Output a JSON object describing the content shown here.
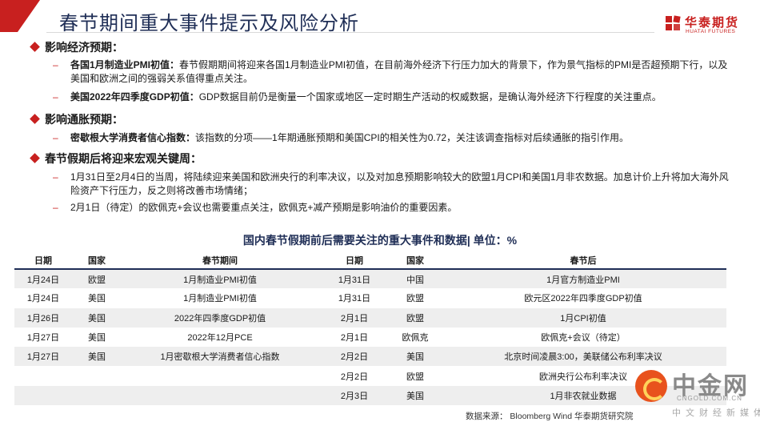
{
  "header": {
    "title": "春节期间重大事件提示及风险分析",
    "logo_cn": "华泰期货",
    "logo_en": "HUATAI FUTURES"
  },
  "sections": [
    {
      "heading": "影响经济预期：",
      "bullets": [
        {
          "label": "各国1月制造业PMI初值：",
          "text": "春节假期期间将迎来各国1月制造业PMI初值，在目前海外经济下行压力加大的背景下，作为景气指标的PMI是否超预期下行，以及美国和欧洲之间的强弱关系值得重点关注。"
        },
        {
          "label": "美国2022年四季度GDP初值：",
          "text": "GDP数据目前仍是衡量一个国家或地区一定时期生产活动的权威数据，是确认海外经济下行程度的关注重点。"
        }
      ]
    },
    {
      "heading": "影响通胀预期：",
      "bullets": [
        {
          "label": "密歇根大学消费者信心指数：",
          "text": "该指数的分项——1年期通胀预期和美国CPI的相关性为0.72，关注该调查指标对后续通胀的指引作用。"
        }
      ]
    },
    {
      "heading": "春节假期后将迎来宏观关键周：",
      "bullets": [
        {
          "label": "",
          "text": "1月31日至2月4日的当周，将陆续迎来美国和欧洲央行的利率决议，以及对加息预期影响较大的欧盟1月CPI和美国1月非农数据。加息计价上升将加大海外风险资产下行压力，反之则将改善市场情绪；"
        },
        {
          "label": "",
          "text": "2月1日（待定）的欧佩克+会议也需要重点关注，欧佩克+减产预期是影响油价的重要因素。"
        }
      ]
    }
  ],
  "table": {
    "title": "国内春节假期前后需要关注的重大事件和数据| 单位：%",
    "headers": [
      "日期",
      "国家",
      "春节期间",
      "日期",
      "国家",
      "春节后"
    ],
    "rows": [
      [
        "1月24日",
        "欧盟",
        "1月制造业PMI初值",
        "1月31日",
        "中国",
        "1月官方制造业PMI"
      ],
      [
        "1月24日",
        "美国",
        "1月制造业PMI初值",
        "1月31日",
        "欧盟",
        "欧元区2022年四季度GDP初值"
      ],
      [
        "1月26日",
        "美国",
        "2022年四季度GDP初值",
        "2月1日",
        "欧盟",
        "1月CPI初值"
      ],
      [
        "1月27日",
        "美国",
        "2022年12月PCE",
        "2月1日",
        "欧佩克",
        "欧佩克+会议（待定）"
      ],
      [
        "1月27日",
        "美国",
        "1月密歇根大学消费者信心指数",
        "2月2日",
        "美国",
        "北京时间凌晨3:00，美联储公布利率决议"
      ],
      [
        "",
        "",
        "",
        "2月2日",
        "欧盟",
        "欧洲央行公布利率决议"
      ],
      [
        "",
        "",
        "",
        "2月3日",
        "美国",
        "1月非农就业数据"
      ]
    ]
  },
  "source": "数据来源：  Bloomberg Wind  华泰期货研究院",
  "watermark_logo": {
    "cn": "中金网",
    "domain": "CNGOLD.COM.CN",
    "slogan": "中文财经新媒体"
  },
  "colors": {
    "accent": "#c8201f",
    "title": "#1f2e56",
    "row_shade": "#eeeeee"
  }
}
